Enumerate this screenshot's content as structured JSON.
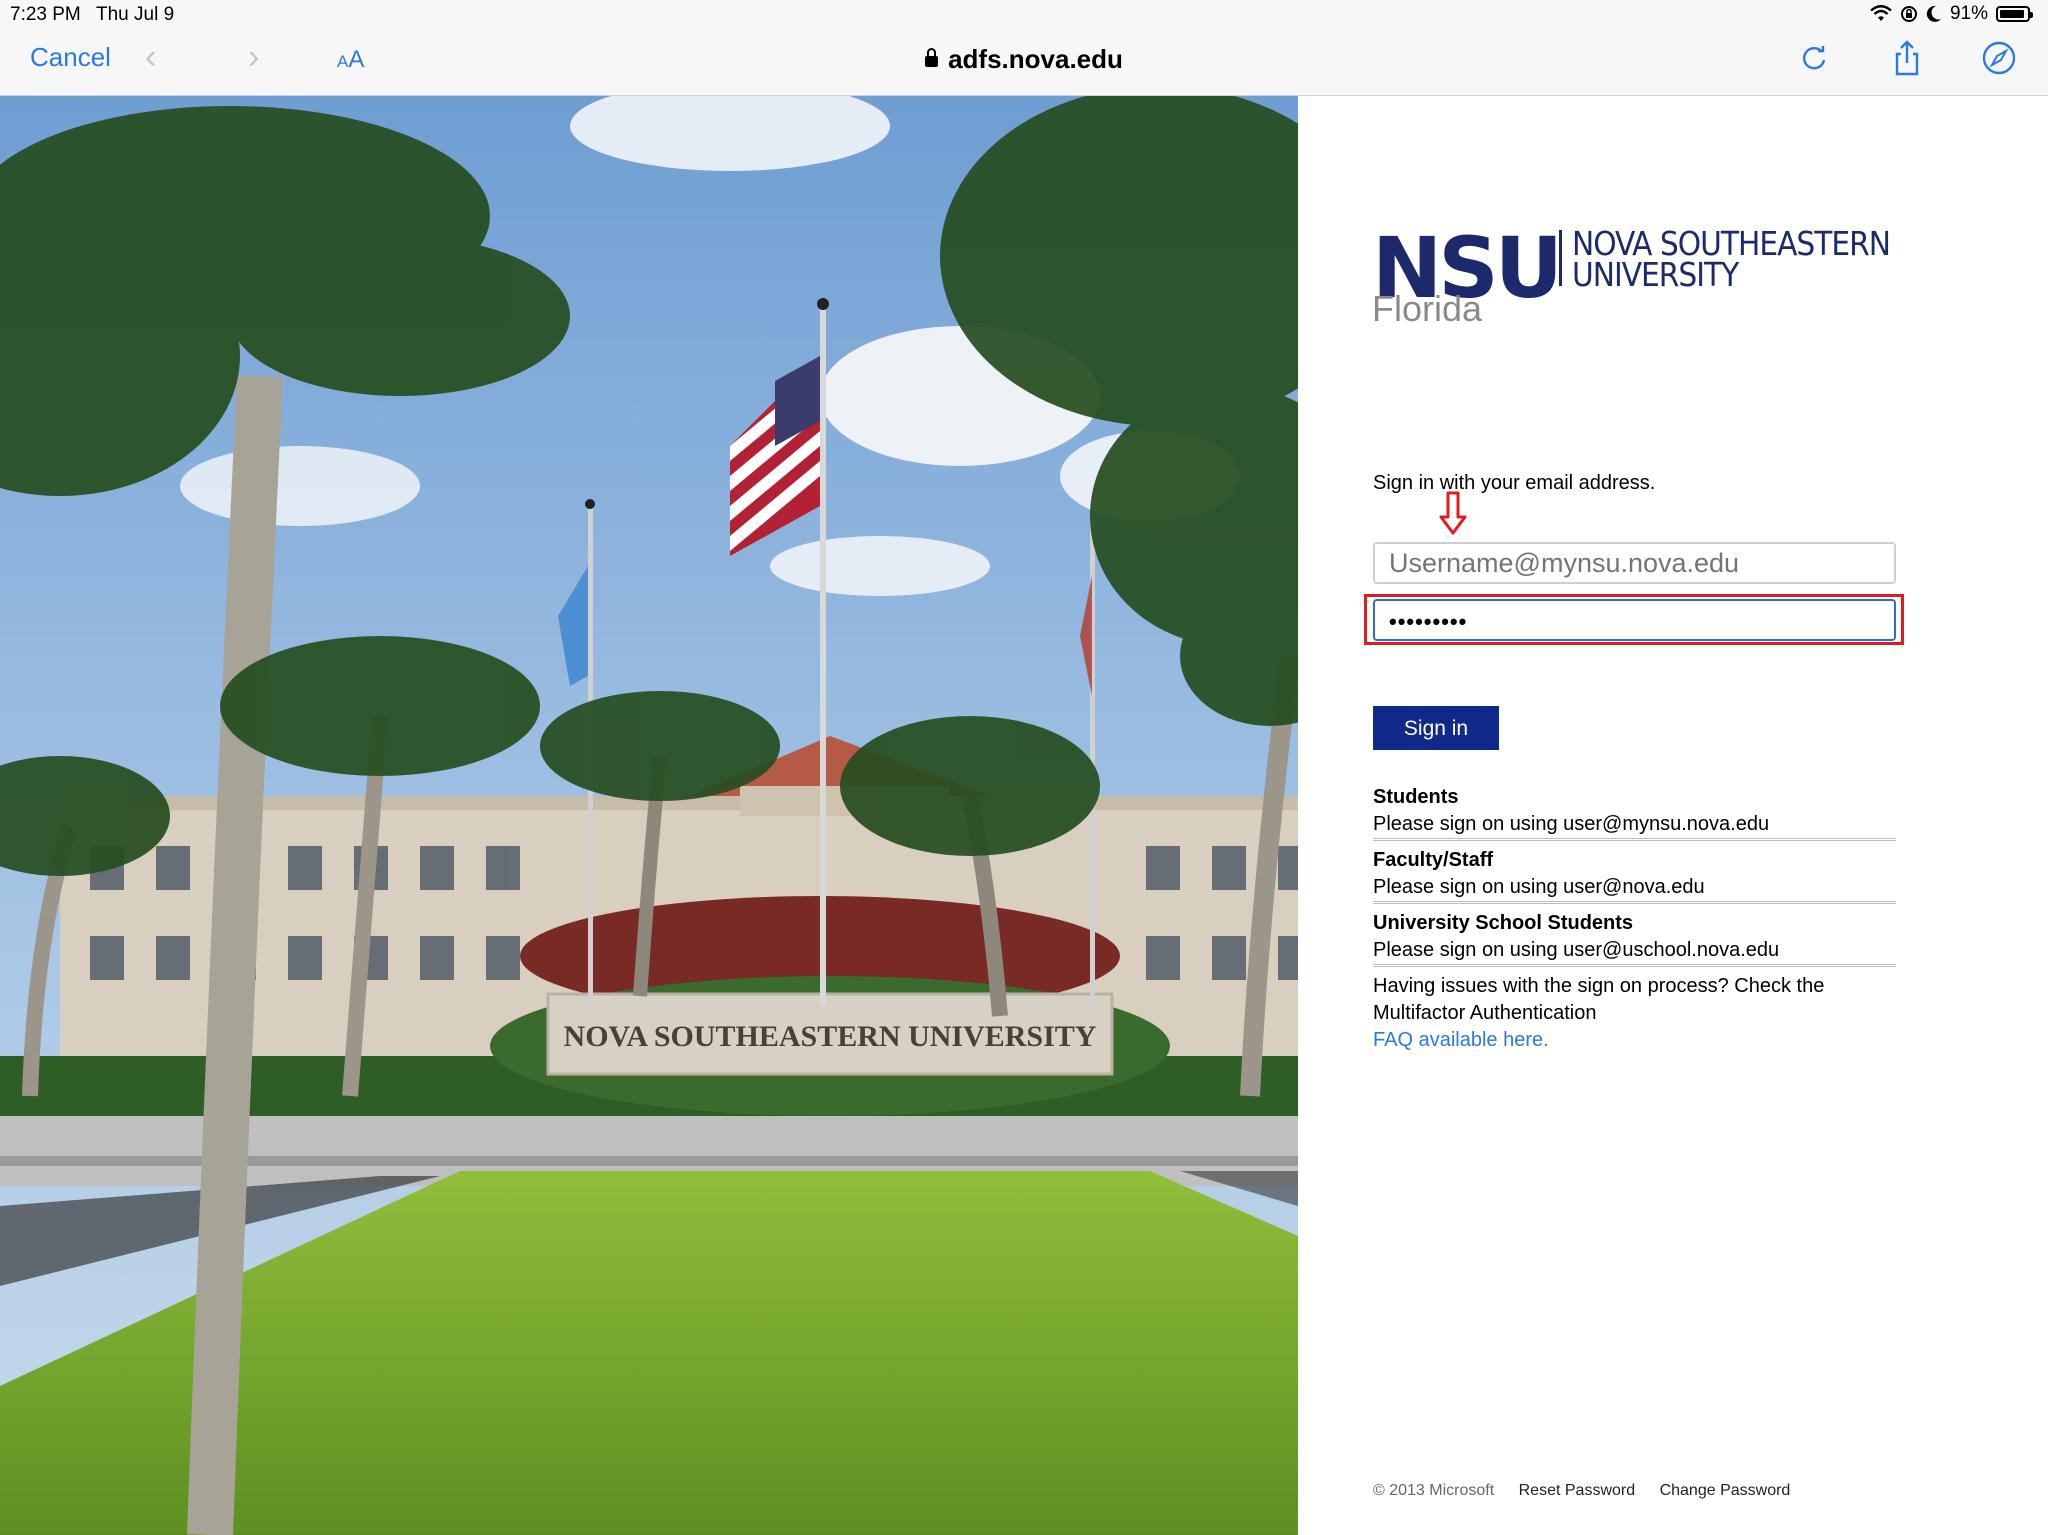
{
  "status_bar": {
    "time": "7:23 PM",
    "date": "Thu Jul 9",
    "battery": "91%",
    "battery_level": 0.91
  },
  "toolbar": {
    "cancel": "Cancel",
    "text_size_small": "A",
    "text_size_large": "A",
    "url": "adfs.nova.edu",
    "accent_color": "#2a7ae2"
  },
  "photo": {
    "sign_text": "NOVA SOUTHEASTERN UNIVERSITY"
  },
  "logo": {
    "mark": "NSU",
    "name_line1": "NOVA SOUTHEASTERN",
    "name_line2": "UNIVERSITY",
    "sub": "Florida",
    "brand_color": "#1c2a6b"
  },
  "login": {
    "prompt": "Sign in with your email address.",
    "username_placeholder": "Username@mynsu.nova.edu",
    "password_value": "•••••••••",
    "signin_label": "Sign in",
    "button_color": "#0f2a8a",
    "annotation_color": "#e21b23"
  },
  "info": {
    "students_heading": "Students",
    "students_text": "Please sign on using user@mynsu.nova.edu",
    "faculty_heading": "Faculty/Staff",
    "faculty_text": "Please sign on using user@nova.edu",
    "uschool_heading": "University School Students",
    "uschool_text": "Please sign on using user@uschool.nova.edu",
    "issues_text": "Having issues with the sign on process? Check the Multifactor Authentication",
    "faq_link": "FAQ available here."
  },
  "footer": {
    "copyright": "© 2013 Microsoft",
    "reset": "Reset Password",
    "change": "Change Password"
  }
}
